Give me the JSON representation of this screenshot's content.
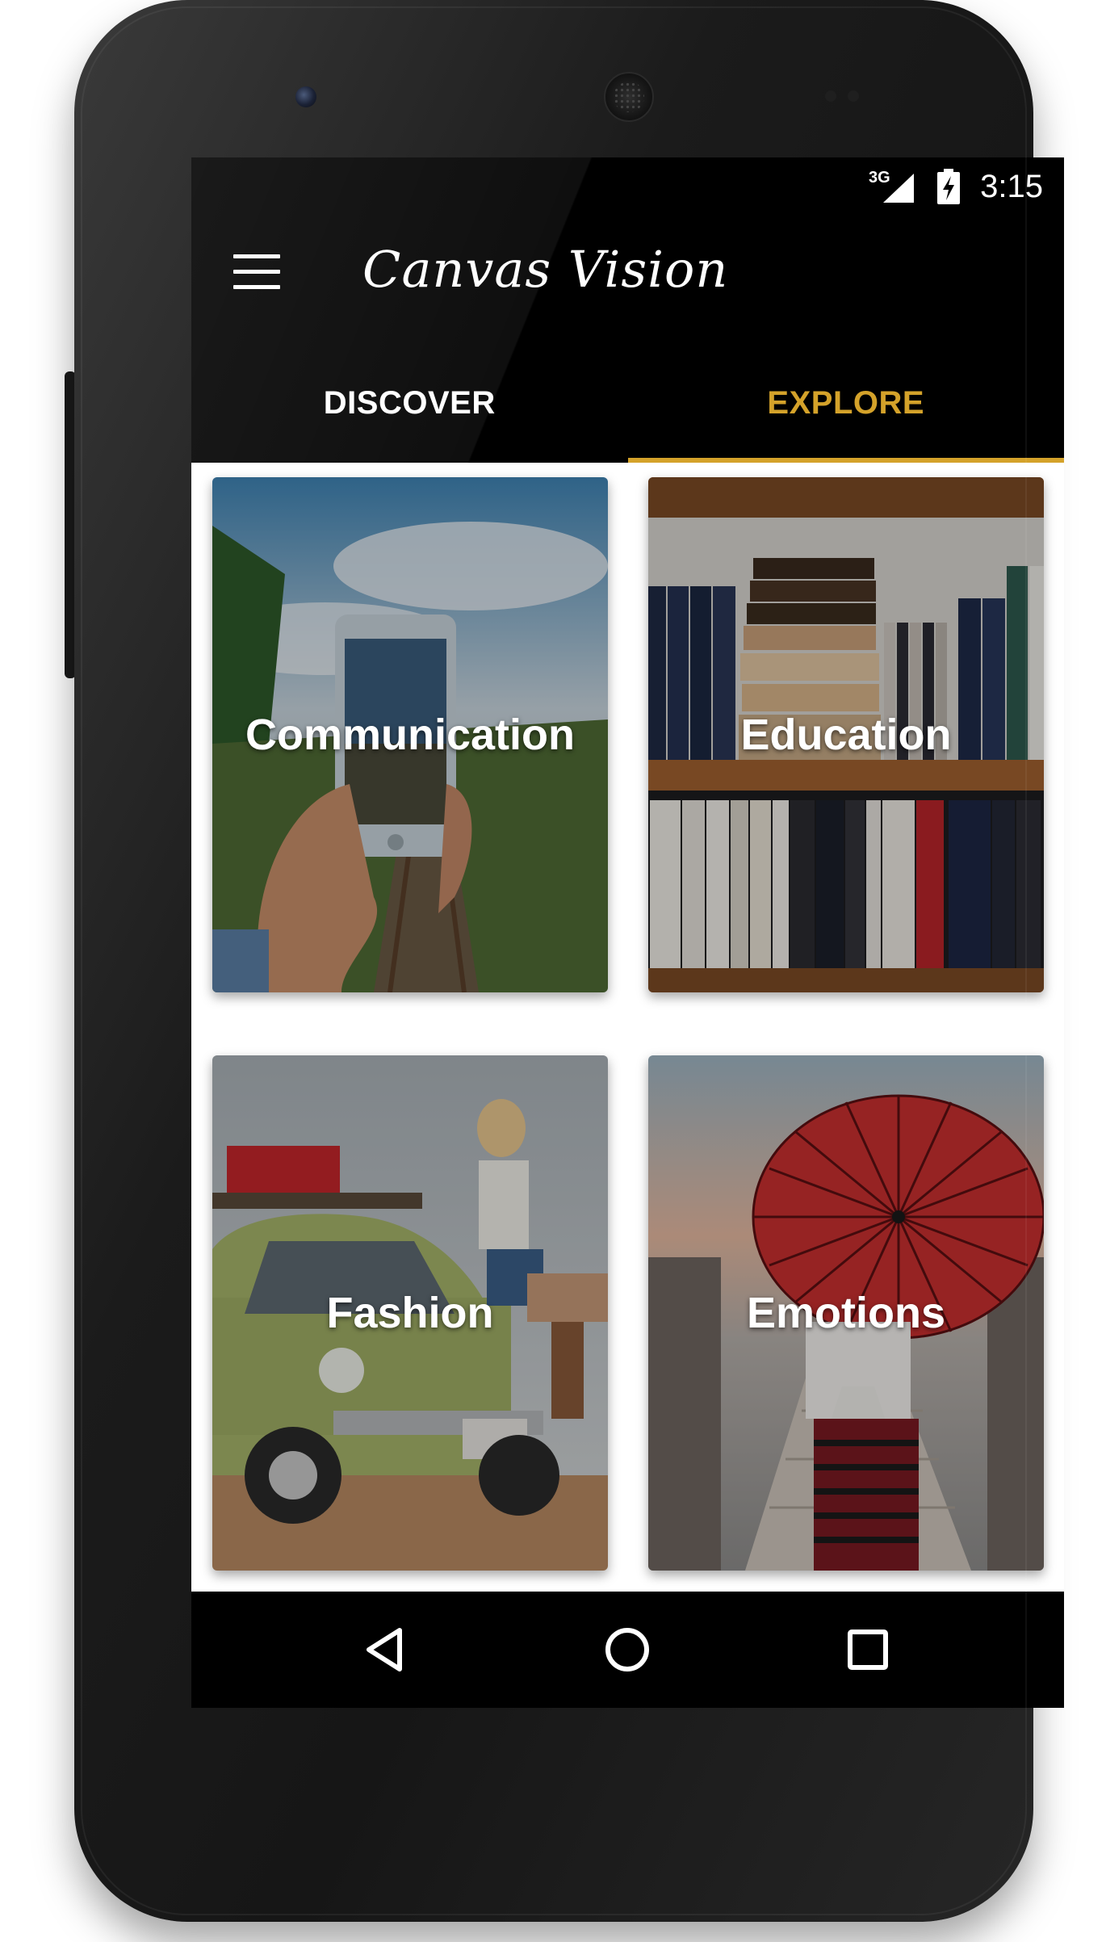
{
  "status_bar": {
    "network": "3G",
    "time": "3:15"
  },
  "app_bar": {
    "title": "Canvas Vision",
    "menu_icon": "hamburger-menu-icon"
  },
  "tabs": [
    {
      "label": "DISCOVER",
      "selected": false
    },
    {
      "label": "EXPLORE",
      "selected": true
    }
  ],
  "categories": [
    {
      "label": "Communication"
    },
    {
      "label": "Education"
    },
    {
      "label": "Fashion"
    },
    {
      "label": "Emotions"
    }
  ],
  "nav_bar": {
    "back_icon": "back-triangle-icon",
    "home_icon": "home-circle-icon",
    "recents_icon": "recents-square-icon"
  },
  "colors": {
    "accent": "#d4a22a",
    "app_bar_bg": "#000000",
    "content_bg": "#ffffff",
    "text_on_dark": "#ffffff"
  }
}
